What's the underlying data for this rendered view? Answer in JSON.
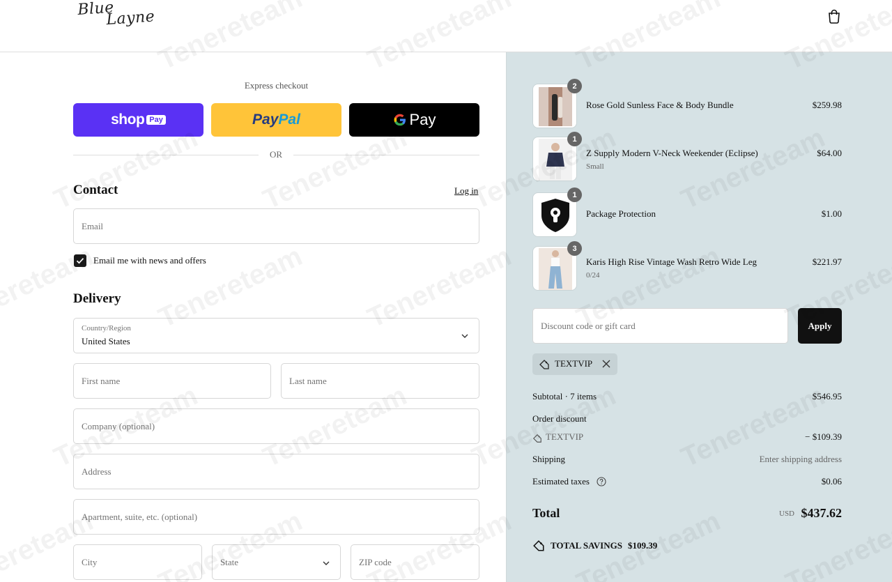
{
  "header": {
    "logo_line1": "Blue",
    "logo_line2": "Layne",
    "cart_icon": "shopping-bag-icon"
  },
  "express": {
    "label": "Express checkout",
    "shop_pay": {
      "word": "shop",
      "badge": "Pay"
    },
    "paypal": {
      "part1": "Pay",
      "part2": "Pal"
    },
    "gpay": {
      "text": "Pay"
    },
    "or_text": "OR"
  },
  "contact": {
    "title": "Contact",
    "login_link": "Log in",
    "email_placeholder": "Email",
    "news_checkbox_label": "Email me with news and offers",
    "news_checked": true
  },
  "delivery": {
    "title": "Delivery",
    "country_label": "Country/Region",
    "country_value": "United States",
    "first_name_placeholder": "First name",
    "last_name_placeholder": "Last name",
    "company_placeholder": "Company (optional)",
    "address_placeholder": "Address",
    "apartment_placeholder": "Apartment, suite, etc. (optional)",
    "city_placeholder": "City",
    "state_placeholder": "State",
    "zip_placeholder": "ZIP code"
  },
  "order": {
    "items": [
      {
        "name": "Rose Gold Sunless Face & Body Bundle",
        "variant": "",
        "qty": "2",
        "price": "$259.98"
      },
      {
        "name": "Z Supply Modern V-Neck Weekender (Eclipse)",
        "variant": "Small",
        "qty": "1",
        "price": "$64.00"
      },
      {
        "name": "Package Protection",
        "variant": "",
        "qty": "1",
        "price": "$1.00"
      },
      {
        "name": "Karis High Rise Vintage Wash Retro Wide Leg",
        "variant": "0/24",
        "qty": "3",
        "price": "$221.97"
      }
    ],
    "discount_placeholder": "Discount code or gift card",
    "apply_label": "Apply",
    "applied_code": "TEXTVIP",
    "subtotal_label": "Subtotal · 7 items",
    "subtotal_value": "$546.95",
    "order_discount_label": "Order discount",
    "discount_code": "TEXTVIP",
    "discount_value": "− $109.39",
    "shipping_label": "Shipping",
    "shipping_value": "Enter shipping address",
    "taxes_label": "Estimated taxes",
    "taxes_value": "$0.06",
    "total_label": "Total",
    "currency": "USD",
    "total_value": "$437.62",
    "savings_label": "TOTAL SAVINGS",
    "savings_value": "$109.39"
  },
  "watermark": "Tenereteam",
  "colors": {
    "shop_pay": "#5a31f4",
    "paypal": "#ffc439",
    "gpay": "#000000",
    "summary_bg": "#d6e2e5",
    "apply_bg": "#111111"
  }
}
